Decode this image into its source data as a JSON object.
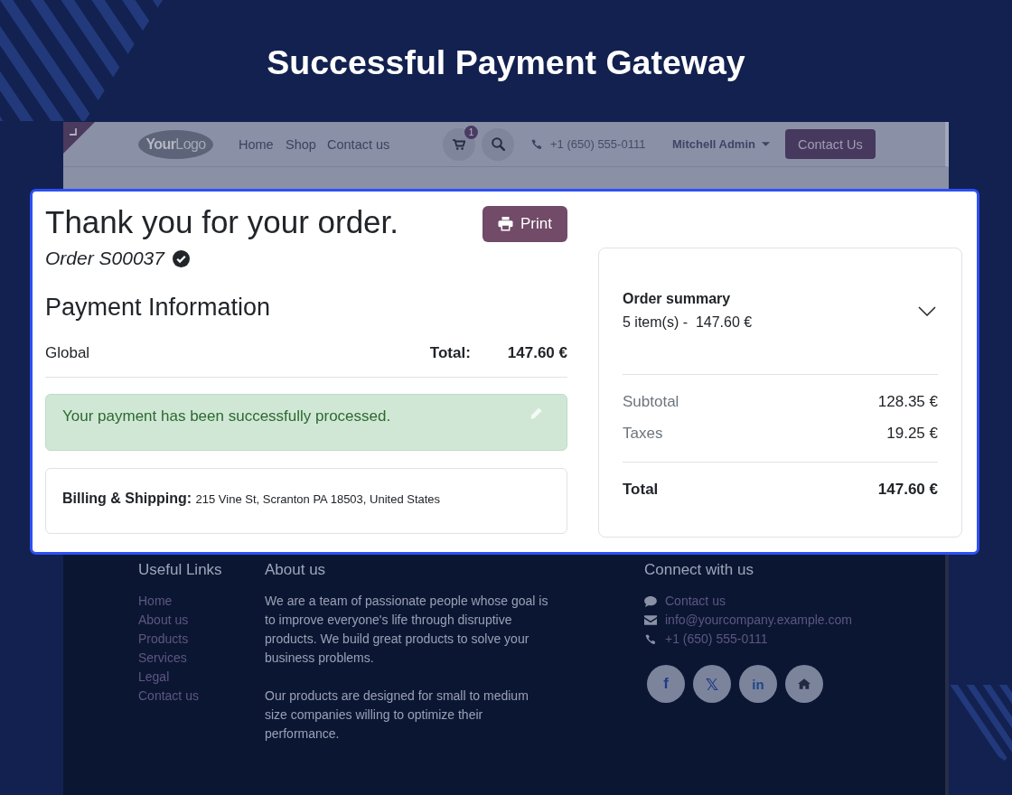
{
  "title": "Successful Payment Gateway",
  "navbar": {
    "logo": "**Your**Logo",
    "links": [
      "Home",
      "Shop",
      "Contact us"
    ],
    "cart_count": "1",
    "phone": "+1 (650) 555-0111",
    "user": "Mitchell Admin",
    "contact_button": "Contact Us"
  },
  "confirmation": {
    "heading": "Thank you for your order.",
    "print_button": "Print",
    "order": "Order S00037",
    "payment_heading": "Payment Information",
    "payment_method": "Global",
    "total_label": "Total:",
    "total": "147.60 €",
    "alert": "Your payment has been successfully processed.",
    "billing_label": "Billing & Shipping:",
    "billing_address": "215 Vine St, Scranton PA 18503, United States"
  },
  "summary": {
    "title": "Order summary",
    "items": "5 item(s) -  147.60 €",
    "expanded": false,
    "lines": [
      {
        "label": "Subtotal",
        "value": "128.35 €"
      },
      {
        "label": "Taxes",
        "value": "19.25 €"
      }
    ],
    "total_label": "Total",
    "total": "147.60 €"
  },
  "footer": {
    "useful_links": {
      "heading": "Useful Links",
      "links": [
        "Home",
        "About us",
        "Products",
        "Services",
        "Legal",
        "Contact us"
      ]
    },
    "about": {
      "heading": "About us",
      "paragraphs": [
        "We are a team of passionate people whose goal is to improve everyone's life through disruptive products. We build great products to solve your business problems.",
        "Our products are designed for small to medium size companies willing to optimize their performance."
      ]
    },
    "connect": {
      "heading": "Connect with us",
      "contacts": [
        {
          "kind": "chat",
          "text": "Contact us"
        },
        {
          "kind": "email",
          "text": "info@yourcompany.example.com"
        },
        {
          "kind": "phone",
          "text": "+1 (650) 555-0111"
        }
      ],
      "social": [
        {
          "kind": "facebook",
          "glyph": "f"
        },
        {
          "kind": "x",
          "glyph": "𝕏"
        },
        {
          "kind": "linkedin",
          "glyph": "in"
        },
        {
          "kind": "home"
        }
      ]
    }
  }
}
